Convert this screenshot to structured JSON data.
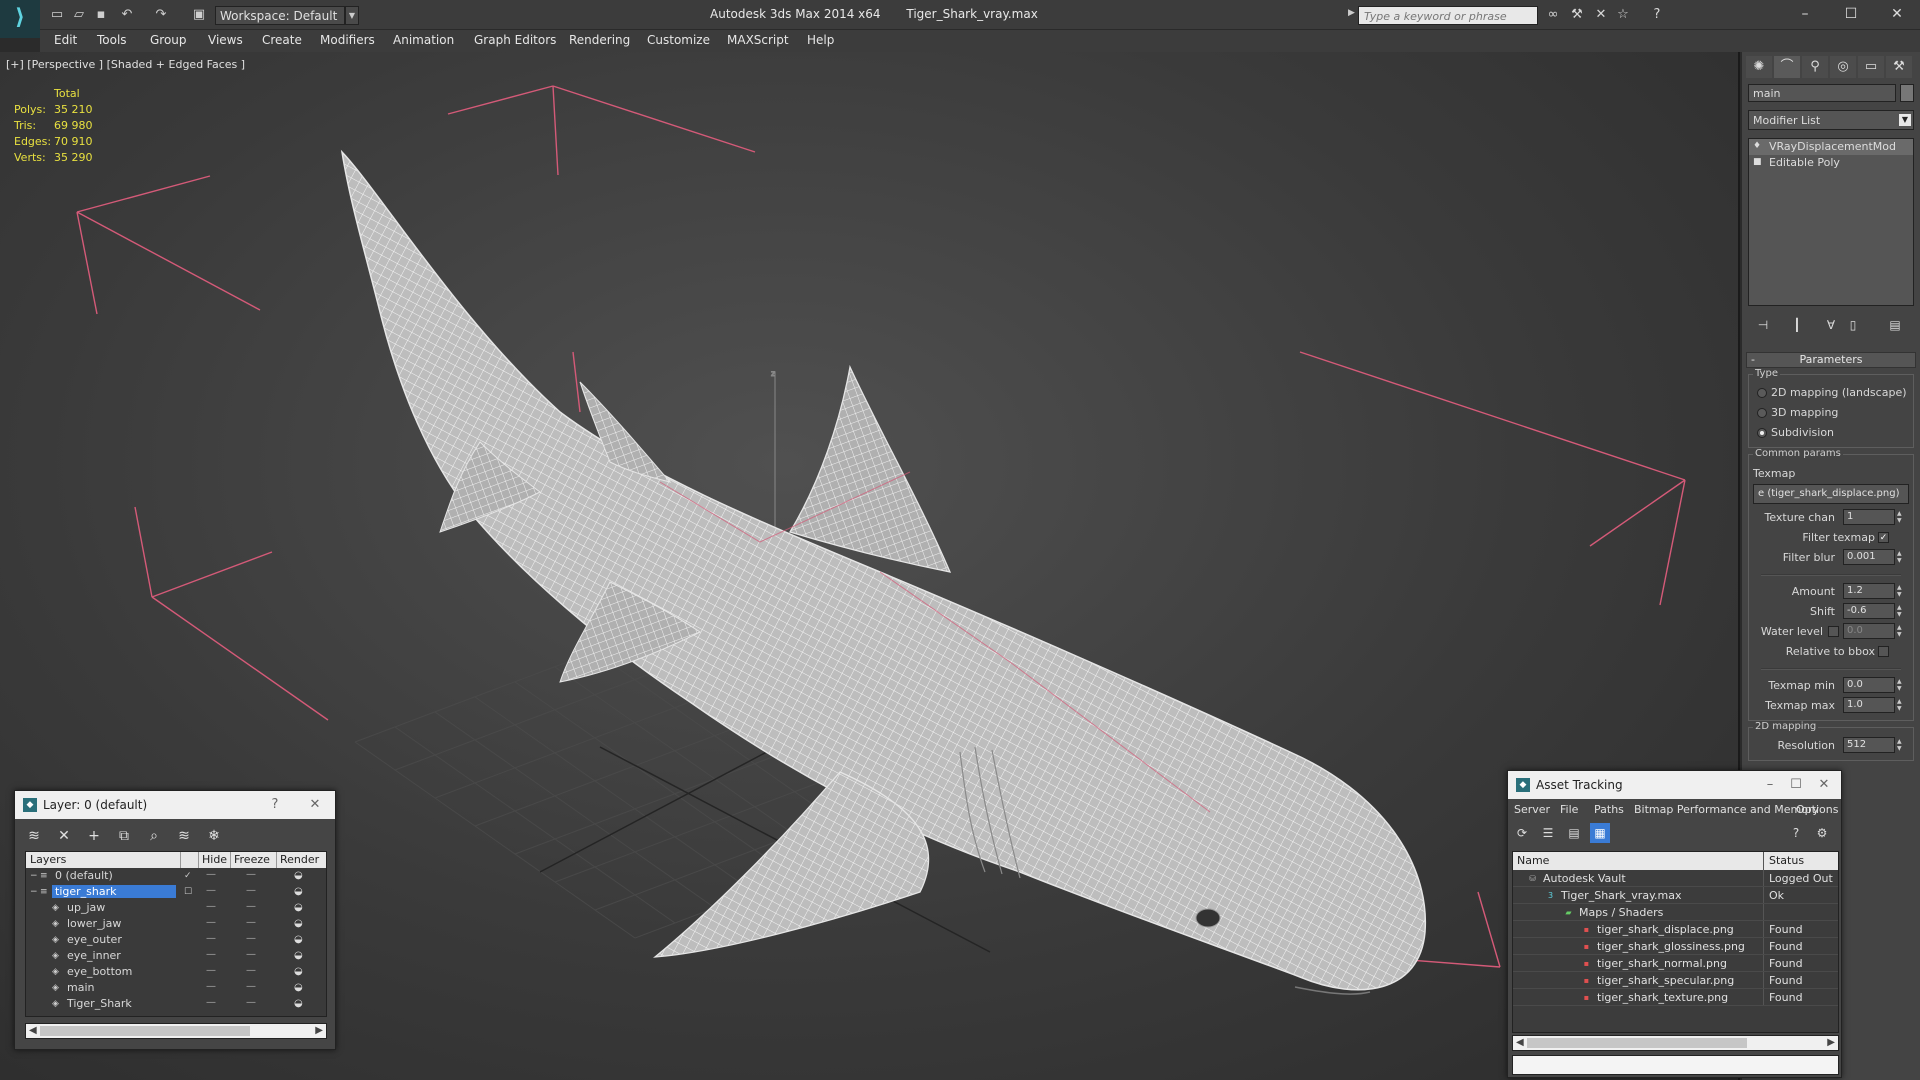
{
  "titlebar": {
    "workspace": "Workspace: Default",
    "app_name": "Autodesk 3ds Max  2014 x64",
    "file_name": "Tiger_Shark_vray.max",
    "search_placeholder": "Type a keyword or phrase"
  },
  "menu": [
    "Edit",
    "Tools",
    "Group",
    "Views",
    "Create",
    "Modifiers",
    "Animation",
    "Graph Editors",
    "Rendering",
    "Customize",
    "MAXScript",
    "Help"
  ],
  "viewport": {
    "label": "[+] [Perspective ] [Shaded + Edged Faces ]",
    "stats_header": "Total",
    "stats": [
      {
        "label": "Polys:",
        "value": "35 210"
      },
      {
        "label": "Tris:",
        "value": "69 980"
      },
      {
        "label": "Edges:",
        "value": "70 910"
      },
      {
        "label": "Verts:",
        "value": "35 290"
      }
    ],
    "gizmo_axis": "z"
  },
  "command_panel": {
    "object_name": "main",
    "modifier_list": "Modifier List",
    "stack": [
      {
        "label": "VRayDisplacementMod",
        "selected": true
      },
      {
        "label": "Editable Poly",
        "selected": false
      }
    ],
    "parameters_title": "Parameters",
    "type_group": "Type",
    "type_options": [
      {
        "label": "2D mapping (landscape)",
        "selected": false
      },
      {
        "label": "3D mapping",
        "selected": false
      },
      {
        "label": "Subdivision",
        "selected": true
      }
    ],
    "common_group": "Common params",
    "texmap_label": "Texmap",
    "texmap_value": "e (tiger_shark_displace.png)",
    "texture_chan_label": "Texture chan",
    "texture_chan": "1",
    "filter_texmap_label": "Filter texmap",
    "filter_blur_label": "Filter blur",
    "filter_blur": "0.001",
    "amount_label": "Amount",
    "amount": "1.2",
    "shift_label": "Shift",
    "shift": "-0.6",
    "water_level_label": "Water level",
    "water_level": "0.0",
    "relative_bbox_label": "Relative to bbox",
    "texmap_min_label": "Texmap min",
    "texmap_min": "0.0",
    "texmap_max_label": "Texmap max",
    "texmap_max": "1.0",
    "mapping2d_group": "2D mapping",
    "resolution_label": "Resolution",
    "resolution": "512"
  },
  "layer_dialog": {
    "title": "Layer: 0 (default)",
    "help": "?",
    "columns": {
      "layers": "Layers",
      "hide": "Hide",
      "freeze": "Freeze",
      "render": "Render"
    },
    "rows": [
      {
        "name": "0 (default)",
        "level": 0,
        "current": true,
        "selected": false
      },
      {
        "name": "tiger_shark",
        "level": 0,
        "current": false,
        "selected": true
      },
      {
        "name": "up_jaw",
        "level": 1,
        "current": false,
        "selected": false
      },
      {
        "name": "lower_jaw",
        "level": 1,
        "current": false,
        "selected": false
      },
      {
        "name": "eye_outer",
        "level": 1,
        "current": false,
        "selected": false
      },
      {
        "name": "eye_inner",
        "level": 1,
        "current": false,
        "selected": false
      },
      {
        "name": "eye_bottom",
        "level": 1,
        "current": false,
        "selected": false
      },
      {
        "name": "main",
        "level": 1,
        "current": false,
        "selected": false
      },
      {
        "name": "Tiger_Shark",
        "level": 1,
        "current": false,
        "selected": false
      }
    ],
    "dash": "—"
  },
  "asset_dialog": {
    "title": "Asset Tracking",
    "menu": [
      "Server",
      "File",
      "Paths",
      "Bitmap Performance and Memory",
      "Options"
    ],
    "columns": {
      "name": "Name",
      "status": "Status"
    },
    "rows": [
      {
        "name": "Autodesk Vault",
        "status": "Logged Out",
        "level": 0,
        "icon": "vault"
      },
      {
        "name": "Tiger_Shark_vray.max",
        "status": "Ok",
        "level": 1,
        "icon": "max"
      },
      {
        "name": "Maps / Shaders",
        "status": "",
        "level": 2,
        "icon": "maps"
      },
      {
        "name": "tiger_shark_displace.png",
        "status": "Found",
        "level": 3,
        "icon": "png"
      },
      {
        "name": "tiger_shark_glossiness.png",
        "status": "Found",
        "level": 3,
        "icon": "png"
      },
      {
        "name": "tiger_shark_normal.png",
        "status": "Found",
        "level": 3,
        "icon": "png"
      },
      {
        "name": "tiger_shark_specular.png",
        "status": "Found",
        "level": 3,
        "icon": "png"
      },
      {
        "name": "tiger_shark_texture.png",
        "status": "Found",
        "level": 3,
        "icon": "png"
      }
    ]
  },
  "colors": {
    "stats": "#e8e040",
    "bbox": "#e06080",
    "selection": "#3a7bd5"
  }
}
